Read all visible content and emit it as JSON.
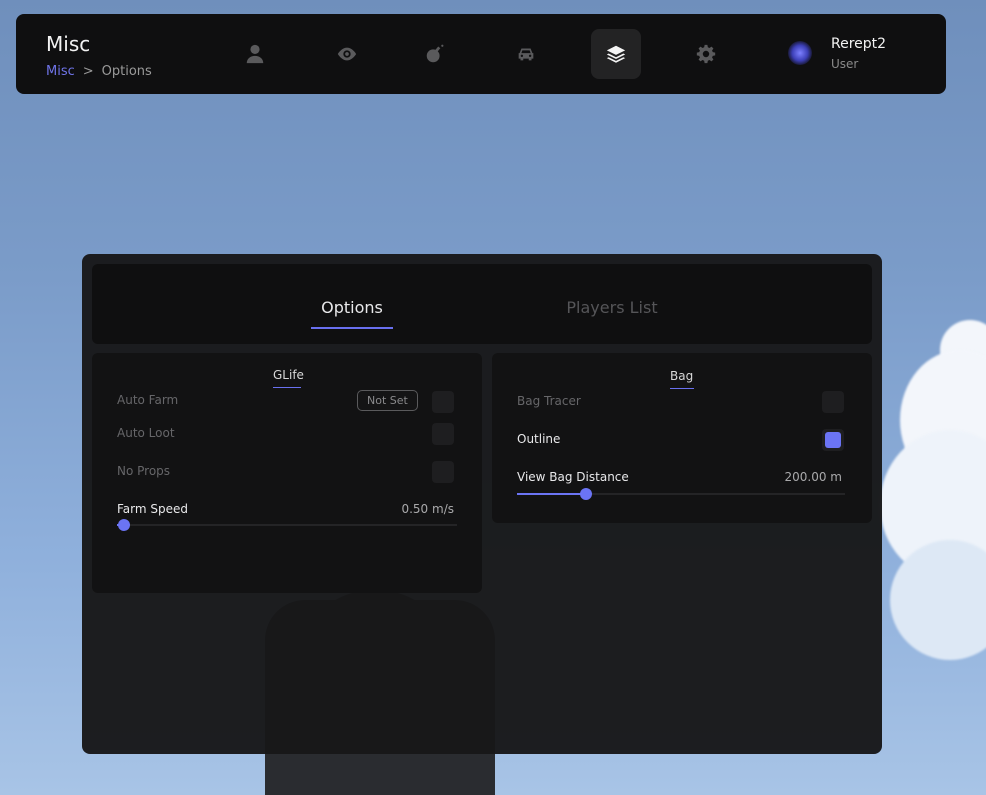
{
  "header": {
    "title": "Misc",
    "breadcrumb": {
      "root": "Misc",
      "separator": ">",
      "current": "Options"
    },
    "nav_icons": [
      "user-icon",
      "eye-icon",
      "bomb-icon",
      "car-icon",
      "layers-icon",
      "gear-icon"
    ],
    "active_nav": "layers-icon",
    "user": {
      "name": "Rerept2",
      "role": "User"
    }
  },
  "tabs": [
    {
      "label": "Options",
      "active": true
    },
    {
      "label": "Players List",
      "active": false
    }
  ],
  "glife": {
    "title": "GLife",
    "auto_farm": {
      "label": "Auto Farm",
      "keybind": "Not Set",
      "checked": false
    },
    "auto_loot": {
      "label": "Auto Loot",
      "checked": false
    },
    "no_props": {
      "label": "No Props",
      "checked": false
    },
    "farm_speed": {
      "label": "Farm Speed",
      "value": "0.50 m/s",
      "fraction": 0.02
    }
  },
  "bag": {
    "title": "Bag",
    "bag_tracer": {
      "label": "Bag Tracer",
      "checked": false
    },
    "outline": {
      "label": "Outline",
      "checked": true
    },
    "view_distance": {
      "label": "View Bag Distance",
      "value": "200.00 m",
      "fraction": 0.21
    }
  },
  "colors": {
    "accent": "#6b74f4",
    "panel": "#181819",
    "card": "#121213"
  }
}
